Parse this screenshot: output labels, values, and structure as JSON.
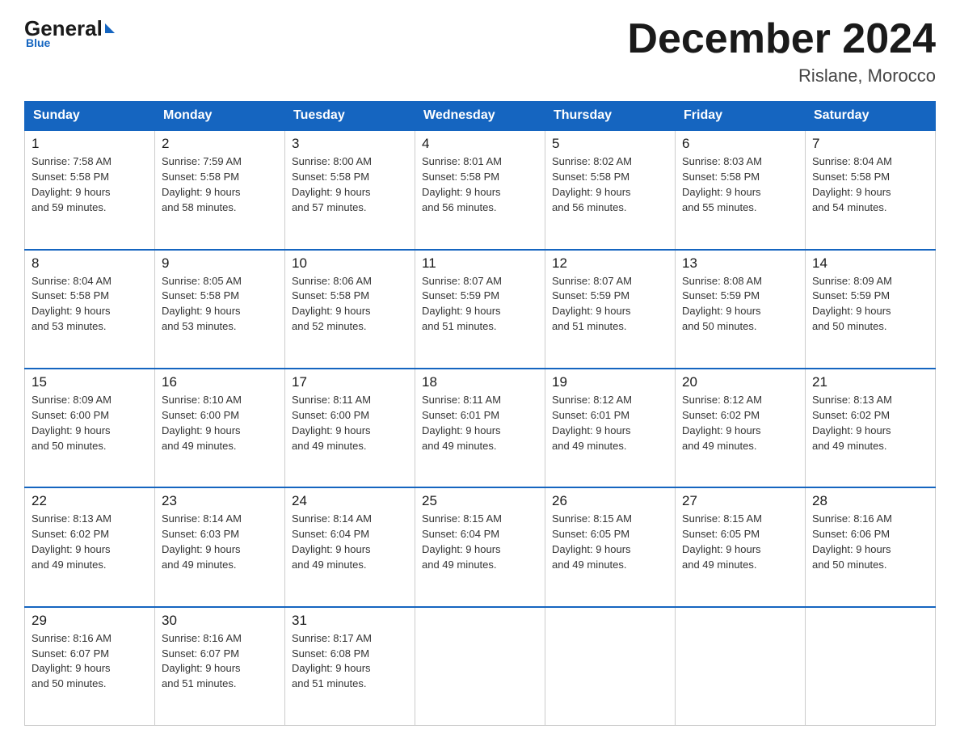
{
  "header": {
    "logo_general": "General",
    "logo_blue": "Blue",
    "main_title": "December 2024",
    "subtitle": "Rislane, Morocco"
  },
  "days_of_week": [
    "Sunday",
    "Monday",
    "Tuesday",
    "Wednesday",
    "Thursday",
    "Friday",
    "Saturday"
  ],
  "weeks": [
    [
      {
        "day": "1",
        "info": "Sunrise: 7:58 AM\nSunset: 5:58 PM\nDaylight: 9 hours\nand 59 minutes."
      },
      {
        "day": "2",
        "info": "Sunrise: 7:59 AM\nSunset: 5:58 PM\nDaylight: 9 hours\nand 58 minutes."
      },
      {
        "day": "3",
        "info": "Sunrise: 8:00 AM\nSunset: 5:58 PM\nDaylight: 9 hours\nand 57 minutes."
      },
      {
        "day": "4",
        "info": "Sunrise: 8:01 AM\nSunset: 5:58 PM\nDaylight: 9 hours\nand 56 minutes."
      },
      {
        "day": "5",
        "info": "Sunrise: 8:02 AM\nSunset: 5:58 PM\nDaylight: 9 hours\nand 56 minutes."
      },
      {
        "day": "6",
        "info": "Sunrise: 8:03 AM\nSunset: 5:58 PM\nDaylight: 9 hours\nand 55 minutes."
      },
      {
        "day": "7",
        "info": "Sunrise: 8:04 AM\nSunset: 5:58 PM\nDaylight: 9 hours\nand 54 minutes."
      }
    ],
    [
      {
        "day": "8",
        "info": "Sunrise: 8:04 AM\nSunset: 5:58 PM\nDaylight: 9 hours\nand 53 minutes."
      },
      {
        "day": "9",
        "info": "Sunrise: 8:05 AM\nSunset: 5:58 PM\nDaylight: 9 hours\nand 53 minutes."
      },
      {
        "day": "10",
        "info": "Sunrise: 8:06 AM\nSunset: 5:58 PM\nDaylight: 9 hours\nand 52 minutes."
      },
      {
        "day": "11",
        "info": "Sunrise: 8:07 AM\nSunset: 5:59 PM\nDaylight: 9 hours\nand 51 minutes."
      },
      {
        "day": "12",
        "info": "Sunrise: 8:07 AM\nSunset: 5:59 PM\nDaylight: 9 hours\nand 51 minutes."
      },
      {
        "day": "13",
        "info": "Sunrise: 8:08 AM\nSunset: 5:59 PM\nDaylight: 9 hours\nand 50 minutes."
      },
      {
        "day": "14",
        "info": "Sunrise: 8:09 AM\nSunset: 5:59 PM\nDaylight: 9 hours\nand 50 minutes."
      }
    ],
    [
      {
        "day": "15",
        "info": "Sunrise: 8:09 AM\nSunset: 6:00 PM\nDaylight: 9 hours\nand 50 minutes."
      },
      {
        "day": "16",
        "info": "Sunrise: 8:10 AM\nSunset: 6:00 PM\nDaylight: 9 hours\nand 49 minutes."
      },
      {
        "day": "17",
        "info": "Sunrise: 8:11 AM\nSunset: 6:00 PM\nDaylight: 9 hours\nand 49 minutes."
      },
      {
        "day": "18",
        "info": "Sunrise: 8:11 AM\nSunset: 6:01 PM\nDaylight: 9 hours\nand 49 minutes."
      },
      {
        "day": "19",
        "info": "Sunrise: 8:12 AM\nSunset: 6:01 PM\nDaylight: 9 hours\nand 49 minutes."
      },
      {
        "day": "20",
        "info": "Sunrise: 8:12 AM\nSunset: 6:02 PM\nDaylight: 9 hours\nand 49 minutes."
      },
      {
        "day": "21",
        "info": "Sunrise: 8:13 AM\nSunset: 6:02 PM\nDaylight: 9 hours\nand 49 minutes."
      }
    ],
    [
      {
        "day": "22",
        "info": "Sunrise: 8:13 AM\nSunset: 6:02 PM\nDaylight: 9 hours\nand 49 minutes."
      },
      {
        "day": "23",
        "info": "Sunrise: 8:14 AM\nSunset: 6:03 PM\nDaylight: 9 hours\nand 49 minutes."
      },
      {
        "day": "24",
        "info": "Sunrise: 8:14 AM\nSunset: 6:04 PM\nDaylight: 9 hours\nand 49 minutes."
      },
      {
        "day": "25",
        "info": "Sunrise: 8:15 AM\nSunset: 6:04 PM\nDaylight: 9 hours\nand 49 minutes."
      },
      {
        "day": "26",
        "info": "Sunrise: 8:15 AM\nSunset: 6:05 PM\nDaylight: 9 hours\nand 49 minutes."
      },
      {
        "day": "27",
        "info": "Sunrise: 8:15 AM\nSunset: 6:05 PM\nDaylight: 9 hours\nand 49 minutes."
      },
      {
        "day": "28",
        "info": "Sunrise: 8:16 AM\nSunset: 6:06 PM\nDaylight: 9 hours\nand 50 minutes."
      }
    ],
    [
      {
        "day": "29",
        "info": "Sunrise: 8:16 AM\nSunset: 6:07 PM\nDaylight: 9 hours\nand 50 minutes."
      },
      {
        "day": "30",
        "info": "Sunrise: 8:16 AM\nSunset: 6:07 PM\nDaylight: 9 hours\nand 51 minutes."
      },
      {
        "day": "31",
        "info": "Sunrise: 8:17 AM\nSunset: 6:08 PM\nDaylight: 9 hours\nand 51 minutes."
      },
      {
        "day": "",
        "info": ""
      },
      {
        "day": "",
        "info": ""
      },
      {
        "day": "",
        "info": ""
      },
      {
        "day": "",
        "info": ""
      }
    ]
  ]
}
